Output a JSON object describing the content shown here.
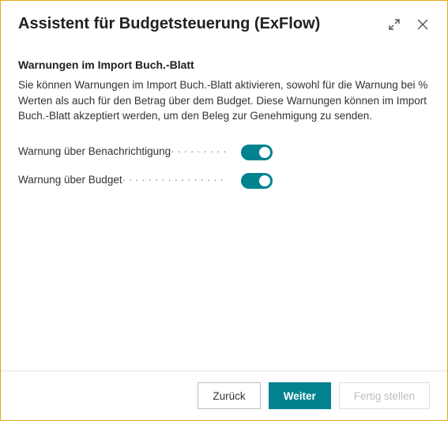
{
  "header": {
    "title": "Assistent für Budgetsteuerung (ExFlow)"
  },
  "section": {
    "title": "Warnungen im Import Buch.-Blatt",
    "description": "Sie können Warnungen im Import Buch.-Blatt aktivieren, sowohl für die Warnung bei % Werten als auch für den Betrag über dem Budget. Diese Warnungen können im Import Buch.-Blatt akzeptiert werden, um den Beleg zur Genehmigung zu senden."
  },
  "fields": {
    "warn_notification": {
      "label": "Warnung über Benachrichtigung",
      "value": true
    },
    "warn_budget": {
      "label": "Warnung über Budget",
      "value": true
    }
  },
  "footer": {
    "back": "Zurück",
    "next": "Weiter",
    "finish": "Fertig stellen"
  },
  "colors": {
    "accent": "#00838f",
    "border": "#e6a817"
  }
}
